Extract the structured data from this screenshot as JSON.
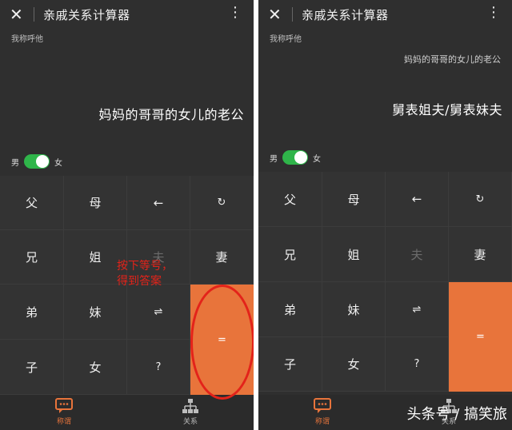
{
  "panels": [
    {
      "title": "亲戚关系计算器",
      "hint": "我称呼他",
      "expression": "",
      "result": "妈妈的哥哥的女儿的老公",
      "gender": {
        "male": "男",
        "female": "女"
      },
      "keys": [
        [
          "父",
          "母",
          "←",
          "↻"
        ],
        [
          "兄",
          "姐",
          "夫",
          "妻"
        ],
        [
          "弟",
          "妹",
          "⇌",
          "="
        ],
        [
          "子",
          "女",
          "?",
          ""
        ]
      ],
      "tabs": {
        "active": "称谓",
        "other": "关系"
      },
      "annotation": [
        "按下等号，",
        "得到答案"
      ]
    },
    {
      "title": "亲戚关系计算器",
      "hint": "我称呼他",
      "expression": "妈妈的哥哥的女儿的老公",
      "result": "舅表姐夫/舅表妹夫",
      "gender": {
        "male": "男",
        "female": "女"
      },
      "keys": [
        [
          "父",
          "母",
          "←",
          "↻"
        ],
        [
          "兄",
          "姐",
          "夫",
          "妻"
        ],
        [
          "弟",
          "妹",
          "⇌",
          "="
        ],
        [
          "子",
          "女",
          "?",
          ""
        ]
      ],
      "tabs": {
        "active": "称谓",
        "other": "关系"
      }
    }
  ],
  "watermark": "头条号 / 搞笑旅",
  "colors": {
    "accent": "#e8743b",
    "toggle": "#2fb54a",
    "annotation": "#e3231a"
  }
}
